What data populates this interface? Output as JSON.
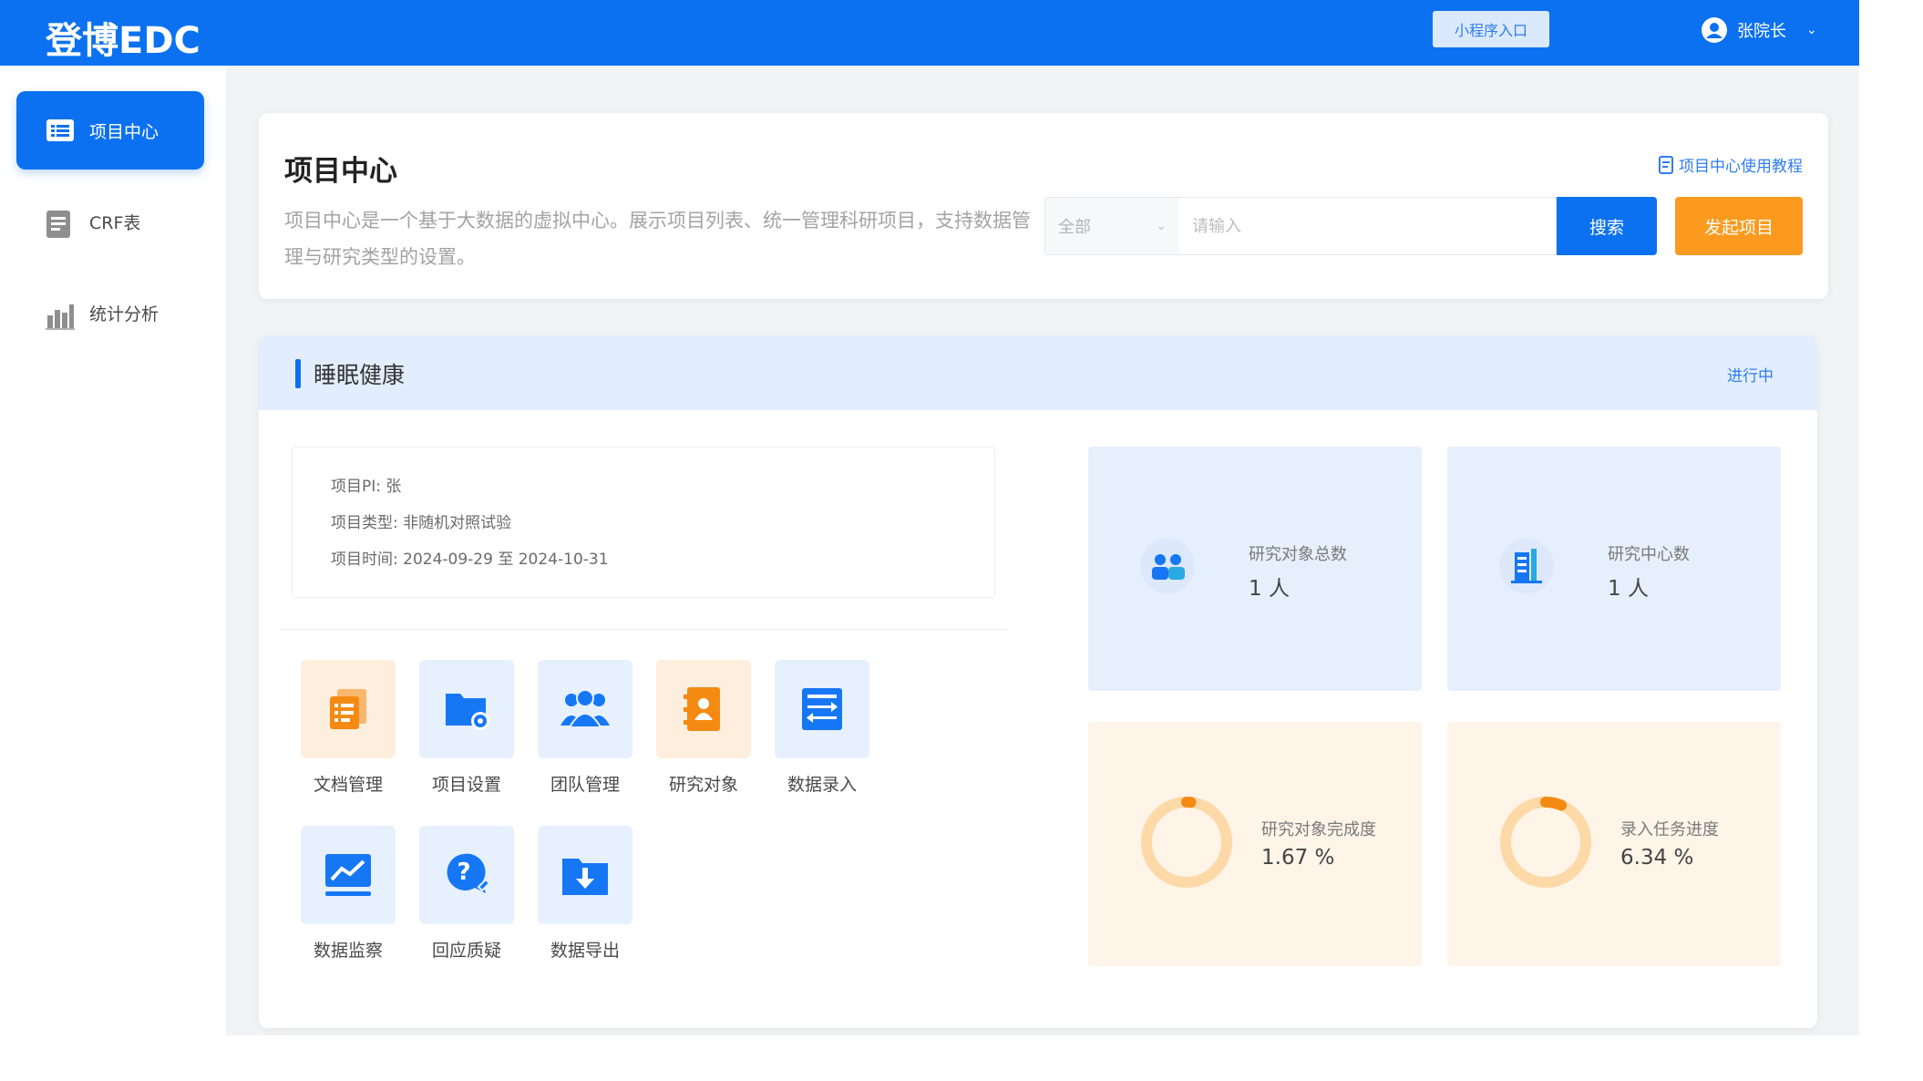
{
  "app": {
    "logo": "登博EDC",
    "miniprogram_entry": "小程序入口",
    "user_name": "张院长"
  },
  "sidebar": {
    "items": [
      {
        "label": "项目中心",
        "active": true
      },
      {
        "label": "CRF表",
        "active": false
      },
      {
        "label": "统计分析",
        "active": false
      }
    ]
  },
  "header": {
    "title": "项目中心",
    "description": "项目中心是一个基于大数据的虚拟中心。展示项目列表、统一管理科研项目，支持数据管理与研究类型的设置。",
    "tutorial_link": "项目中心使用教程",
    "search": {
      "scope": "全部",
      "placeholder": "请输入",
      "value": "",
      "search_label": "搜索",
      "start_label": "发起项目"
    }
  },
  "project": {
    "name": "睡眠健康",
    "status": "进行中",
    "info": [
      {
        "label": "项目PI:",
        "value": "张"
      },
      {
        "label": "项目类型:",
        "value": "非随机对照试验"
      },
      {
        "label": "项目时间:",
        "value": "2024-09-29 至 2024-10-31"
      }
    ],
    "tools": [
      {
        "label": "文档管理",
        "icon": "document-icon"
      },
      {
        "label": "项目设置",
        "icon": "folder-settings-icon"
      },
      {
        "label": "团队管理",
        "icon": "team-icon"
      },
      {
        "label": "研究对象",
        "icon": "contact-book-icon"
      },
      {
        "label": "数据录入",
        "icon": "data-entry-icon"
      },
      {
        "label": "数据监察",
        "icon": "monitor-chart-icon"
      },
      {
        "label": "回应质疑",
        "icon": "question-bubble-icon"
      },
      {
        "label": "数据导出",
        "icon": "export-folder-icon"
      }
    ],
    "stats": [
      {
        "label": "研究对象总数",
        "value": "1 人"
      },
      {
        "label": "研究中心数",
        "value": "1 人"
      },
      {
        "label": "研究对象完成度",
        "value": "1.67 %",
        "percent": 1.67
      },
      {
        "label": "录入任务进度",
        "value": "6.34 %",
        "percent": 6.34
      }
    ]
  },
  "colors": {
    "primary": "#0c71f0",
    "accent": "#fb9a1e",
    "tool_blue": "#1677f5",
    "tool_orange": "#f58a13"
  }
}
